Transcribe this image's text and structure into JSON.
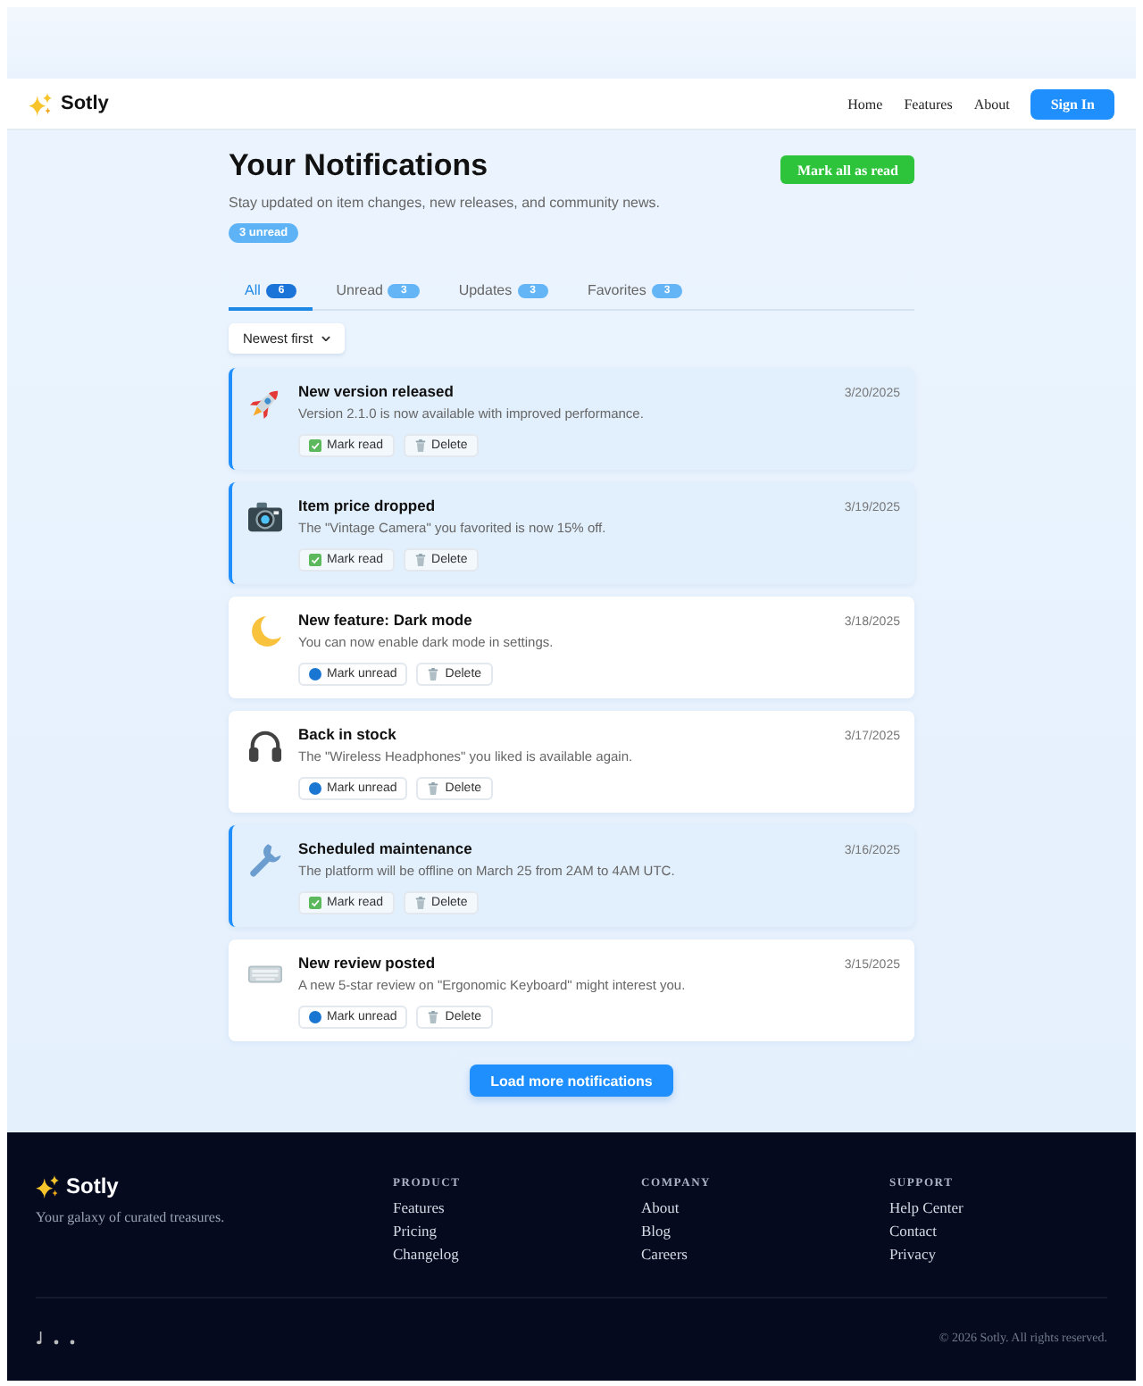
{
  "navbar": {
    "brand": "Sotly",
    "links": [
      "Home",
      "Features",
      "About"
    ],
    "button": "Sign In"
  },
  "header": {
    "title": "Your Notifications",
    "subtitle": "Stay updated on item changes, new releases, and community news.",
    "unread_badge": "3 unread",
    "button": "Mark all as read"
  },
  "tabs": [
    {
      "label": "All",
      "count": "6",
      "selected": true
    },
    {
      "label": "Unread",
      "count": "3",
      "selected": false
    },
    {
      "label": "Updates",
      "count": "3",
      "selected": false
    },
    {
      "label": "Favorites",
      "count": "3",
      "selected": false
    }
  ],
  "sort": {
    "value": "Newest first"
  },
  "notifications": [
    {
      "title": "New version released",
      "message": "Version 2.1.0 is now available with improved performance.",
      "date": "3/20/2025",
      "unread": true,
      "action": "Mark read",
      "delete": "Delete"
    },
    {
      "title": "Item price dropped",
      "message": "The \"Vintage Camera\" you favorited is now 15% off.",
      "date": "3/19/2025",
      "unread": true,
      "action": "Mark read",
      "delete": "Delete"
    },
    {
      "title": "New feature: Dark mode",
      "message": "You can now enable dark mode in settings.",
      "date": "3/18/2025",
      "unread": false,
      "action": "Mark unread",
      "delete": "Delete"
    },
    {
      "title": "Back in stock",
      "message": "The \"Wireless Headphones\" you liked is available again.",
      "date": "3/17/2025",
      "unread": false,
      "action": "Mark unread",
      "delete": "Delete"
    },
    {
      "title": "Scheduled maintenance",
      "message": "The platform will be offline on March 25 from 2AM to 4AM UTC.",
      "date": "3/16/2025",
      "unread": true,
      "action": "Mark read",
      "delete": "Delete"
    },
    {
      "title": "New review posted",
      "message": "A new 5-star review on \"Ergonomic Keyboard\" might interest you.",
      "date": "3/15/2025",
      "unread": false,
      "action": "Mark unread",
      "delete": "Delete"
    }
  ],
  "load_more": "Load more notifications",
  "footer": {
    "brand": "Sotly",
    "tagline": "Your galaxy of curated treasures.",
    "columns": [
      {
        "heading": "PRODUCT",
        "links": [
          "Features",
          "Pricing",
          "Changelog"
        ]
      },
      {
        "heading": "COMPANY",
        "links": [
          "About",
          "Blog",
          "Careers"
        ]
      },
      {
        "heading": "SUPPORT",
        "links": [
          "Help Center",
          "Contact",
          "Privacy"
        ]
      }
    ],
    "copyright": "© 2026 Sotly. All rights reserved."
  }
}
